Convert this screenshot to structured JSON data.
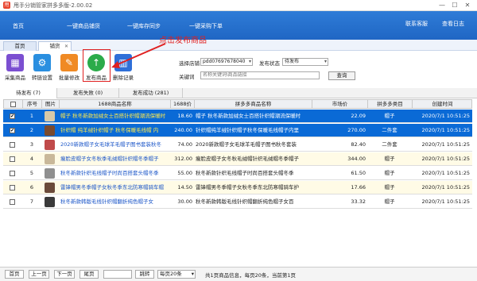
{
  "window": {
    "title": "甩手分销管家拼多多版-2.00.02",
    "min": "—",
    "max": "☐",
    "close": "✕"
  },
  "nav": {
    "items": [
      "首页",
      "一键商品铺货",
      "一键库存同步",
      "一键采购下单"
    ],
    "right_links": [
      "联系客服",
      "查看日志"
    ]
  },
  "tabs": [
    {
      "label": "首页"
    },
    {
      "label": "铺货",
      "close": "✕"
    }
  ],
  "toolbar": {
    "buttons": [
      "采集商品",
      "转链设置",
      "批量修改",
      "发布商品",
      "删除记录"
    ]
  },
  "annotation": {
    "text": "点击发布商品"
  },
  "filters": {
    "shop_label": "选择店铺",
    "shop_value": "pdd07697678040",
    "status_label": "发布状态",
    "status_value": "待发布",
    "keyword_label": "关键词",
    "keyword_placeholder": "名称关键词\\商品链接",
    "search_button": "查询"
  },
  "subtabs": [
    "待发布 (7)",
    "发布失败 (0)",
    "发布成功 (281)"
  ],
  "columns": [
    "序号",
    "图片",
    "1688商品名称",
    "1688价格",
    "拼多多商品名称",
    "市场价",
    "拼多多类目",
    "创建时间"
  ],
  "colors": {
    "nav": "#2f7cd7",
    "selected_row": "#0a6ad6",
    "alt_row": "#fffbe6",
    "annotation": "#e02020"
  },
  "rows": [
    {
      "no": "1",
      "checked": "✔",
      "title": "帽子 秋冬新款加绒女士百搭针织帽潮流保暖时",
      "price": "18.60",
      "name": "帽子 秋冬新款加绒女士百搭针织帽潮流保暖时",
      "market": "22.09",
      "cat": "帽子",
      "time": "2020/7/1 10:51:25",
      "thumb": "#d8c9a8"
    },
    {
      "no": "2",
      "checked": "✔",
      "title": "针织帽 纯羊绒针织帽子 秋冬保暖毛线帽 内",
      "price": "240.00",
      "name": "针织帽纯羊绒针织帽子秋冬保暖毛线帽子内里",
      "market": "270.00",
      "cat": "二件套",
      "time": "2020/7/1 10:51:25",
      "thumb": "#7a4a2e"
    },
    {
      "no": "3",
      "checked": "",
      "title": "2020新款帽子女毛球羊毛帽子图书套装秋冬",
      "price": "74.00",
      "name": "2020新款帽子女毛球羊毛帽子图书秋冬套装",
      "market": "82.40",
      "cat": "二件套",
      "time": "2020/7/1 10:51:25",
      "thumb": "#c04a4a"
    },
    {
      "no": "4",
      "checked": "",
      "title": "瘦脸皮帽子女冬秋季毛绒帽针织帽冬季帽子",
      "price": "312.00",
      "name": "瘦脸皮帽子女冬秋毛绒帽针织毛绒帽冬季帽子",
      "market": "344.00",
      "cat": "帽子",
      "time": "2020/7/1 10:51:25",
      "thumb": "#c9b89a"
    },
    {
      "no": "5",
      "checked": "",
      "title": "秋冬新款针织毛线帽子时尚百搭套头帽冬季",
      "price": "55.00",
      "name": "秋冬新款针织毛线帽子时尚百搭套头帽冬季",
      "market": "61.50",
      "cat": "帽子",
      "time": "2020/7/1 10:51:25",
      "thumb": "#8f8f8f"
    },
    {
      "no": "6",
      "checked": "",
      "title": "雷锋帽男冬季帽子女秋冬季东北防寒帽骑车帽",
      "price": "14.50",
      "name": "雷锋帽男冬季帽子女秋冬季东北防寒帽骑车护",
      "market": "17.66",
      "cat": "帽子",
      "time": "2020/7/1 10:51:25",
      "thumb": "#6b4a3a"
    },
    {
      "no": "7",
      "checked": "",
      "title": "秋冬新款韩版毛线针织帽翻折纯色帽子女",
      "price": "30.00",
      "name": "秋冬新款韩版毛线针织帽翻折纯色帽子女百",
      "market": "33.32",
      "cat": "帽子",
      "time": "2020/7/1 10:51:25",
      "thumb": "#3a3a3a"
    }
  ],
  "footer": {
    "first": "首页",
    "prev": "上一页",
    "next": "下一页",
    "last": "尾页",
    "jump": "跳转",
    "page_size": "每页20条",
    "info": "共1页商品信息，每页20条，当前第1页"
  }
}
